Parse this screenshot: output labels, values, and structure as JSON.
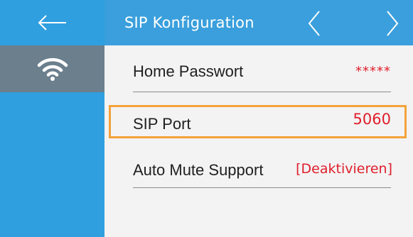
{
  "header": {
    "title": "SIP Konfiguration",
    "prev_icon": "chevron-left-icon",
    "next_icon": "chevron-right-icon"
  },
  "sidebar": {
    "back_icon": "arrow-left-icon",
    "wifi_icon": "wifi-icon"
  },
  "rows": [
    {
      "label": "Home Passwort",
      "value": "*****"
    },
    {
      "label": "SIP Port",
      "value": "5060"
    },
    {
      "label": "Auto Mute Support",
      "value": "[Deaktivieren]"
    }
  ],
  "colors": {
    "sidebar": "#2f9fe0",
    "header": "#3a9fdc",
    "selected_sidebar": "#6b7f8d",
    "value_text": "#e01e2b",
    "highlight_border": "#f4a23a"
  }
}
